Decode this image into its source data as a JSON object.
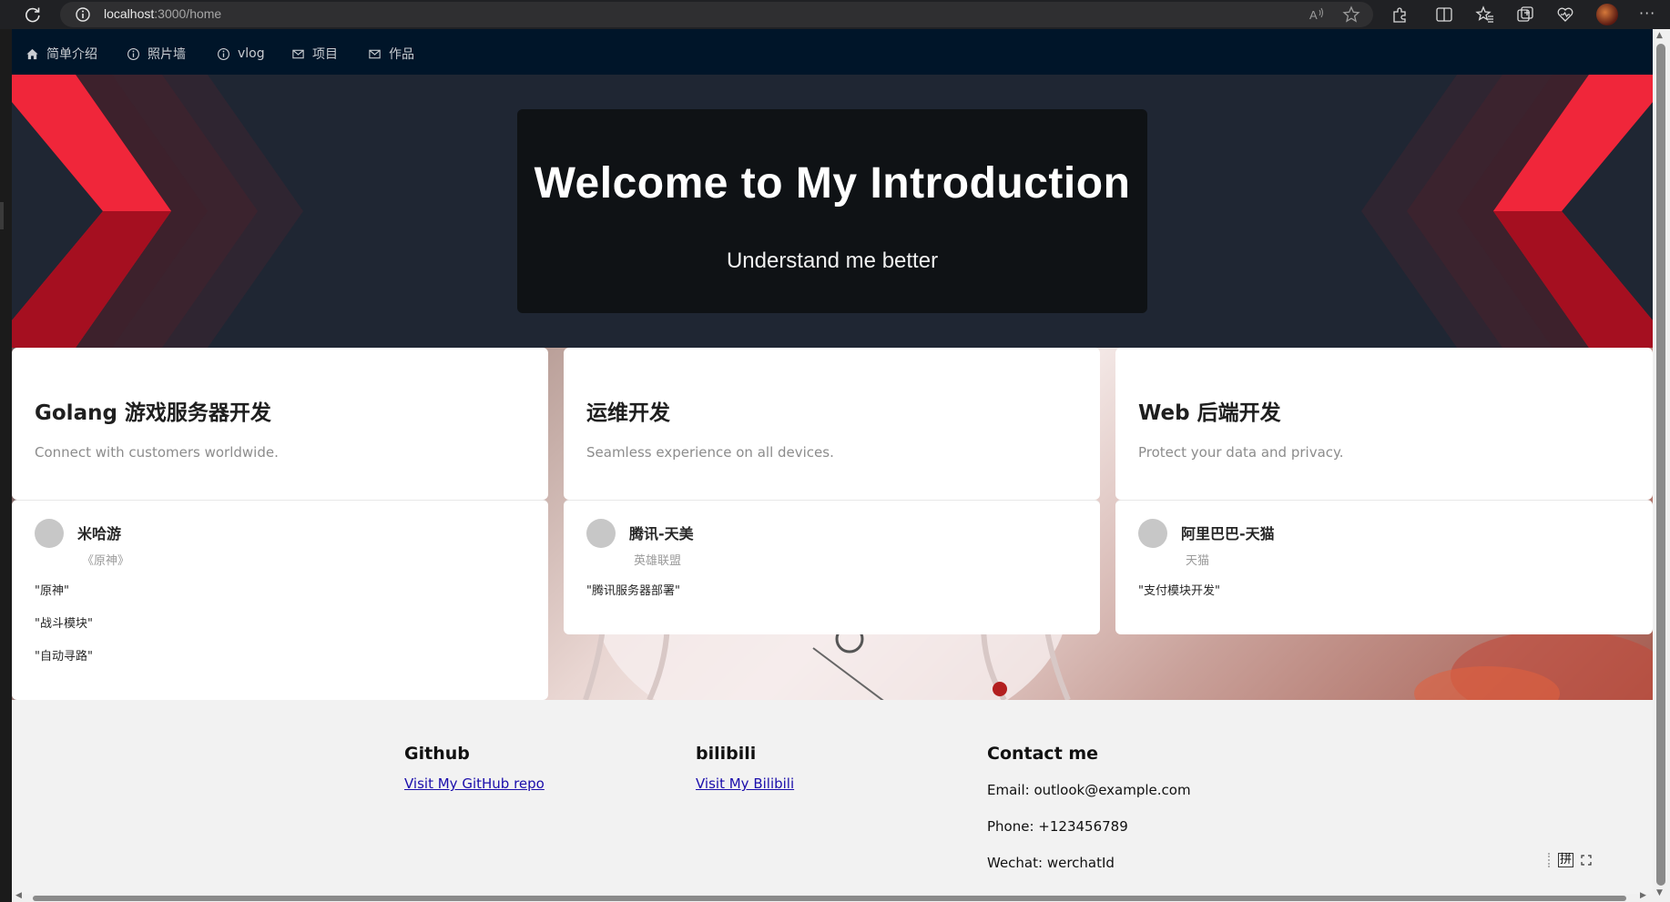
{
  "browser": {
    "url_host": "localhost",
    "url_path": ":3000/home",
    "menu": "···"
  },
  "nav": {
    "items": [
      {
        "label": "简单介绍",
        "icon": "home-icon"
      },
      {
        "label": "照片墙",
        "icon": "info-circle-icon"
      },
      {
        "label": "vlog",
        "icon": "info-circle-icon"
      },
      {
        "label": "项目",
        "icon": "mail-icon"
      },
      {
        "label": "作品",
        "icon": "mail-icon"
      }
    ]
  },
  "hero": {
    "title": "Welcome to My Introduction",
    "subtitle": "Understand me better"
  },
  "cards": [
    {
      "title": "Golang 游戏服务器开发",
      "description": "Connect with customers worldwide.",
      "company": "米哈游",
      "product": "《原神》",
      "items": [
        "\"原神\"",
        "\"战斗模块\"",
        "\"自动寻路\""
      ]
    },
    {
      "title": "运维开发",
      "description": "Seamless experience on all devices.",
      "company": "腾讯-天美",
      "product": "英雄联盟",
      "items": [
        "\"腾讯服务器部署\""
      ]
    },
    {
      "title": "Web 后端开发",
      "description": "Protect your data and privacy.",
      "company": "阿里巴巴-天猫",
      "product": "天猫",
      "items": [
        "\"支付模块开发\""
      ]
    }
  ],
  "footer": {
    "github": {
      "heading": "Github",
      "link": "Visit My GitHub repo"
    },
    "bilibili": {
      "heading": "bilibili",
      "link": "Visit My Bilibili"
    },
    "contact": {
      "heading": "Contact me",
      "email": "Email: outlook@example.com",
      "phone": "Phone: +123456789",
      "wechat": "Wechat: werchatId"
    }
  },
  "ime": {
    "label": "拼"
  },
  "colors": {
    "nav_bg": "#001529",
    "hero_bg": "#1f2633",
    "accent_red": "#e0162b",
    "link": "#1a0dab"
  }
}
